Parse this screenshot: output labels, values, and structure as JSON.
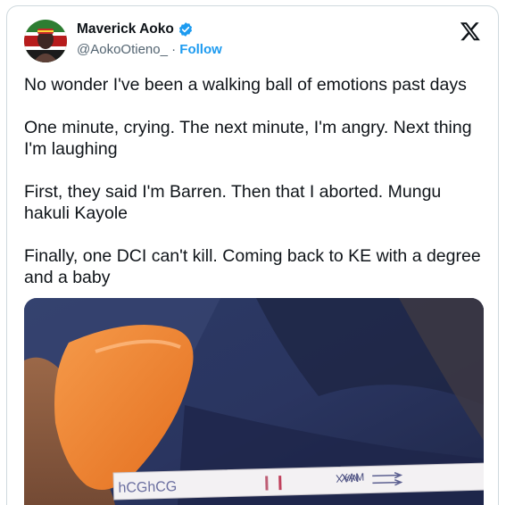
{
  "author": {
    "name": "Maverick Aoko",
    "handle": "@AokoOtieno_",
    "separator": "·",
    "follow_label": "Follow",
    "verified": true,
    "verified_color": "#1d9bf0"
  },
  "header": {
    "logo_icon": "x-logo-icon"
  },
  "tweet": {
    "paragraphs": [
      "No wonder I've been a walking ball of emotions past days",
      "One minute, crying. The next minute, I'm angry. Next thing I'm laughing",
      "First, they said I'm Barren. Then that I aborted. Mungu hakuli Kayole",
      "Finally, one DCI can't kill. Coming back to KE with a degree and a baby"
    ]
  },
  "media": {
    "test_strip": {
      "brand_text": "hCGhCG",
      "max_text": "MAX",
      "max_text_flipped": "XAM"
    }
  },
  "colors": {
    "text": "#0f1419",
    "secondary": "#536471",
    "accent": "#1d9bf0",
    "border": "#cfd9de"
  }
}
